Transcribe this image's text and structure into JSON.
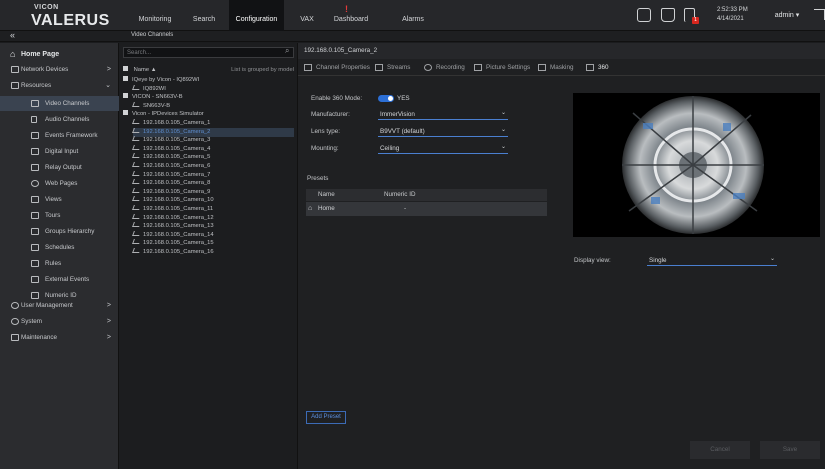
{
  "brand": {
    "top": "VICON",
    "main": "VALERUS"
  },
  "nav": [
    {
      "label": "Monitoring"
    },
    {
      "label": "Search"
    },
    {
      "label": "Configuration"
    },
    {
      "label": "VAX"
    },
    {
      "label": "Dashboard"
    },
    {
      "label": "Alarms"
    }
  ],
  "alarm_badge": "!",
  "notif_badge": "1",
  "clock": {
    "time": "2:52:33 PM",
    "date": "4/14/2021"
  },
  "user": {
    "name": "admin ▾"
  },
  "crumb": {
    "back": "«",
    "title": "Video Channels"
  },
  "sidebar": {
    "home": "Home Page",
    "items": [
      {
        "label": "Network Devices",
        "chev": ">"
      },
      {
        "label": "Resources",
        "chev": "⌄"
      },
      {
        "label": "Video Channels"
      },
      {
        "label": "Audio Channels"
      },
      {
        "label": "Events Framework"
      },
      {
        "label": "Digital Input"
      },
      {
        "label": "Relay Output"
      },
      {
        "label": "Web Pages"
      },
      {
        "label": "Views"
      },
      {
        "label": "Tours"
      },
      {
        "label": "Groups Hierarchy"
      },
      {
        "label": "Schedules"
      },
      {
        "label": "Rules"
      },
      {
        "label": "External Events"
      },
      {
        "label": "Numeric ID"
      },
      {
        "label": "User Management",
        "chev": ">"
      },
      {
        "label": "System",
        "chev": ">"
      },
      {
        "label": "Maintenance",
        "chev": ">"
      }
    ]
  },
  "tree": {
    "search_placeholder": "Search...",
    "header_name": "Name ▲",
    "header_group": "List is grouped by model",
    "rows": [
      "IQeye by Vicon - IQ892WI",
      "IQ892WI",
      "VICON - SN663V-B",
      "SN663V-B",
      "Vicon - IPDevices Simulator",
      "192.168.0.105_Camera_1",
      "192.168.0.105_Camera_2",
      "192.168.0.105_Camera_3",
      "192.168.0.105_Camera_4",
      "192.168.0.105_Camera_5",
      "192.168.0.105_Camera_6",
      "192.168.0.105_Camera_7",
      "192.168.0.105_Camera_8",
      "192.168.0.105_Camera_9",
      "192.168.0.105_Camera_10",
      "192.168.0.105_Camera_11",
      "192.168.0.105_Camera_12",
      "192.168.0.105_Camera_13",
      "192.168.0.105_Camera_14",
      "192.168.0.105_Camera_15",
      "192.168.0.105_Camera_16"
    ]
  },
  "main": {
    "path": "192.168.0.105_Camera_2",
    "tabs": [
      {
        "label": "Channel Properties"
      },
      {
        "label": "Streams"
      },
      {
        "label": "Recording"
      },
      {
        "label": "Picture Settings"
      },
      {
        "label": "Masking"
      },
      {
        "label": "360"
      }
    ],
    "enable_label": "Enable 360 Mode:",
    "enable_value": "YES",
    "manufacturer_label": "Manufacturer:",
    "manufacturer_value": "ImmerVision",
    "lens_label": "Lens type:",
    "lens_value": "B9VVT (default)",
    "mounting_label": "Mounting:",
    "mounting_value": "Ceiling",
    "presets_title": "Presets",
    "col_name": "Name",
    "col_numeric": "Numeric ID",
    "preset_row_name": "Home",
    "preset_row_id": "-",
    "display_view_label": "Display view:",
    "display_view_value": "Single",
    "add_preset": "Add Preset",
    "cancel": "Cancel",
    "save": "Save"
  }
}
